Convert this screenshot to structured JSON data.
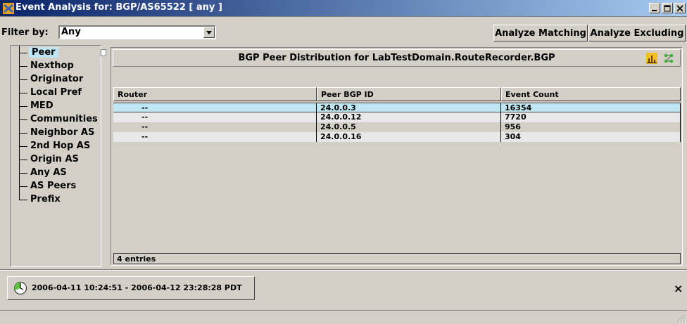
{
  "window": {
    "title": "Event Analysis for: BGP/AS65522 [  any ]"
  },
  "filter": {
    "label": "Filter by:",
    "value": "Any",
    "analyze_matching": "Analyze Matching",
    "analyze_excluding": "Analyze Excluding"
  },
  "tree": {
    "items": [
      {
        "label": "Peer",
        "selected": true
      },
      {
        "label": "Nexthop"
      },
      {
        "label": "Originator"
      },
      {
        "label": "Local Pref"
      },
      {
        "label": "MED"
      },
      {
        "label": "Communities"
      },
      {
        "label": "Neighbor AS"
      },
      {
        "label": "2nd Hop AS"
      },
      {
        "label": "Origin AS"
      },
      {
        "label": "Any AS"
      },
      {
        "label": "AS Peers"
      },
      {
        "label": "Prefix"
      }
    ]
  },
  "panel": {
    "title": "BGP Peer Distribution for LabTestDomain.RouteRecorder.BGP",
    "columns": [
      "Router",
      "Peer BGP ID",
      "Event Count"
    ],
    "rows": [
      {
        "router": "--",
        "peer_bgp_id": "24.0.0.3",
        "event_count": "16354"
      },
      {
        "router": "--",
        "peer_bgp_id": "24.0.0.12",
        "event_count": "7720"
      },
      {
        "router": "--",
        "peer_bgp_id": "24.0.0.5",
        "event_count": "956"
      },
      {
        "router": "--",
        "peer_bgp_id": "24.0.0.16",
        "event_count": "304"
      }
    ],
    "entries": "4 entries"
  },
  "time_range": {
    "text": "2006-04-11 10:24:51 - 2006-04-12 23:28:28 PDT"
  },
  "close_glyph": "×",
  "colors": {
    "title_gradient_start": "#0a246a",
    "title_gradient_end": "#a6caf0",
    "selection": "#bfe6f5",
    "face": "#d4d0c8"
  }
}
